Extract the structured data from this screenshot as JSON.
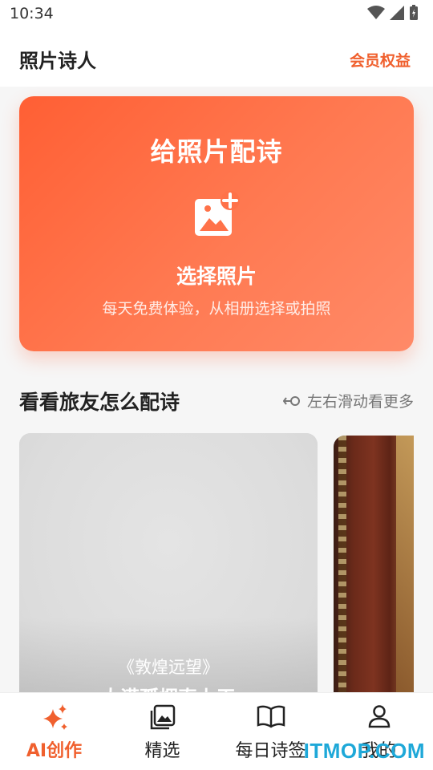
{
  "status": {
    "time": "10:34"
  },
  "header": {
    "title": "照片诗人",
    "vip_label": "会员权益"
  },
  "hero": {
    "title": "给照片配诗",
    "action_label": "选择照片",
    "subtitle": "每天免费体验，从相册选择或拍照",
    "icon": "add-photo-icon"
  },
  "section": {
    "title": "看看旅友怎么配诗",
    "swipe_hint": "左右滑动看更多"
  },
  "cards": [
    {
      "poem_title": "《敦煌远望》",
      "poem_line": "大漠孤烟直上天"
    }
  ],
  "tabs": [
    {
      "label": "AI创作",
      "icon": "sparkle-icon",
      "active": true
    },
    {
      "label": "精选",
      "icon": "gallery-icon",
      "active": false
    },
    {
      "label": "每日诗签",
      "icon": "book-icon",
      "active": false
    },
    {
      "label": "我的",
      "icon": "user-icon",
      "active": false
    }
  ],
  "watermark": "ITMOP.COM",
  "colors": {
    "accent": "#f0602e",
    "hero_start": "#ff5f34",
    "hero_end": "#ff8a68"
  }
}
